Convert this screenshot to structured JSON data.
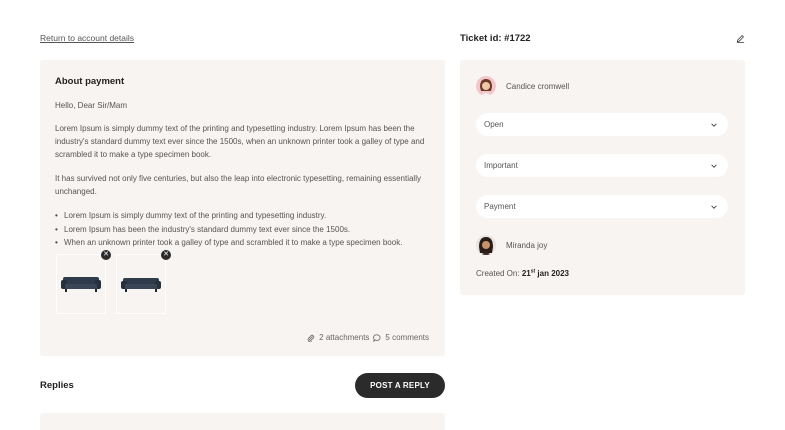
{
  "nav": {
    "back_label": "Return to account details"
  },
  "ticket": {
    "title": "About payment",
    "greeting": "Hello, Dear Sir/Mam",
    "paragraph1": "Lorem Ipsum is simply dummy text of the printing and typesetting industry. Lorem Ipsum has been the industry's standard dummy text ever since the 1500s, when an unknown printer took a galley of type and scrambled it to make a type specimen book.",
    "paragraph2": "It has survived not only five centuries, but also the leap into electronic typesetting, remaining essentially unchanged.",
    "bullets": [
      "Lorem Ipsum is simply dummy text of the printing and typesetting industry.",
      "Lorem Ipsum has been the industry's standard dummy text ever since the 1500s.",
      "When an unknown printer took a galley of type and scrambled it to make a type specimen book."
    ],
    "attachments_label": "2 attachments",
    "comments_label": "5 comments",
    "thumbnail_icons": [
      "sofa-image-icon",
      "sofa-image-icon"
    ]
  },
  "replies": {
    "title": "Replies",
    "post_button": "POST A REPLY"
  },
  "sidebar": {
    "ticket_id_label": "Ticket id:",
    "ticket_id": "#1722",
    "assignee": "Candice cromwell",
    "status": "Open",
    "priority": "Important",
    "category": "Payment",
    "reporter": "Miranda joy",
    "created_label": "Created On:",
    "created_day": "21",
    "created_suffix": "st",
    "created_rest": "jan 2023"
  },
  "colors": {
    "card_bg": "#f7f4f1",
    "button_bg": "#2b2b2b",
    "text_dark": "#222222"
  }
}
